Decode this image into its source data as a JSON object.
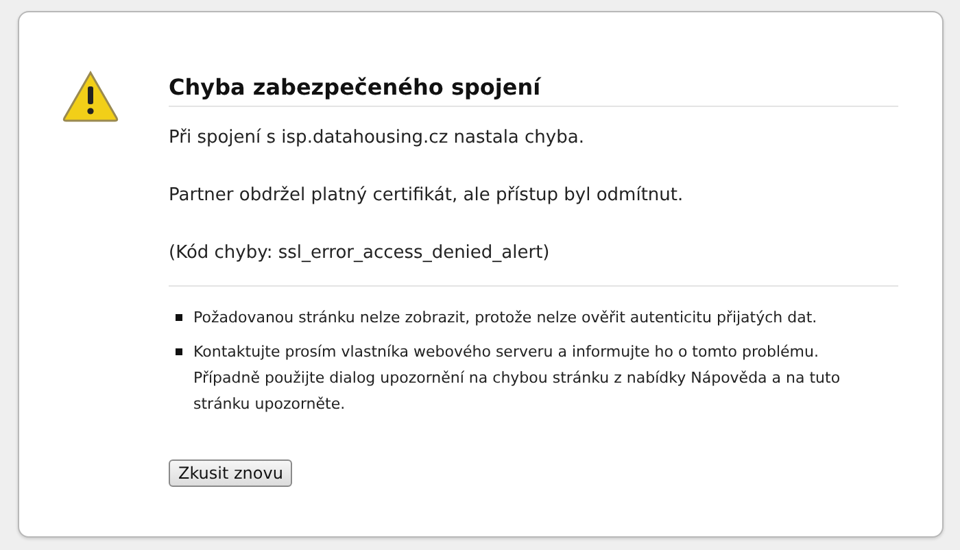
{
  "error_page": {
    "title": "Chyba zabezpečeného spojení",
    "paragraphs": [
      "Při spojení s isp.datahousing.cz nastala chyba.",
      "Partner obdržel platný certifikát, ale přístup byl odmítnut.",
      "(Kód chyby: ssl_error_access_denied_alert)"
    ],
    "bullets": [
      "Požadovanou stránku nelze zobrazit, protože nelze ověřit autenticitu přijatých dat.",
      "Kontaktujte prosím vlastníka webového serveru a informujte ho o tomto problému. Případně použijte dialog upozornění na chybou stránku z nabídky Nápověda a na tuto stránku upozorněte."
    ],
    "button": "Zkusit znovu"
  }
}
